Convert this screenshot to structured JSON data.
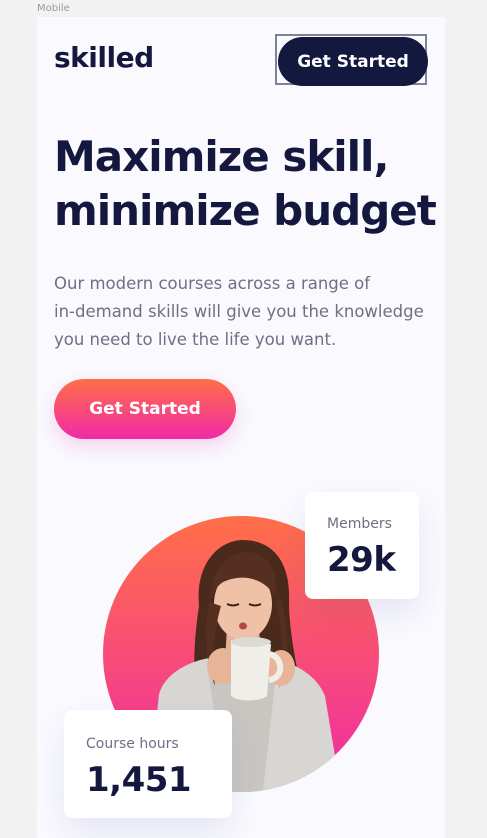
{
  "frame": {
    "label": "Mobile"
  },
  "header": {
    "logo": "skilled",
    "cta_label": "Get Started"
  },
  "hero": {
    "title_lines": [
      "Maximize skill,",
      "minimize budget"
    ],
    "description_lines": [
      "Our modern courses across a range of",
      "in-demand skills will give you the knowledge",
      "you need to live the life you want."
    ],
    "cta_label": "Get Started"
  },
  "stats": {
    "members": {
      "label": "Members",
      "value": "29k"
    },
    "course_hours": {
      "label": "Course hours",
      "value": "1,451"
    }
  },
  "colors": {
    "navy": "#13183f",
    "gradient_start": "#ff6f48",
    "gradient_end": "#f02aa6",
    "body_text": "#6d7083",
    "background": "#f9f9fe"
  }
}
